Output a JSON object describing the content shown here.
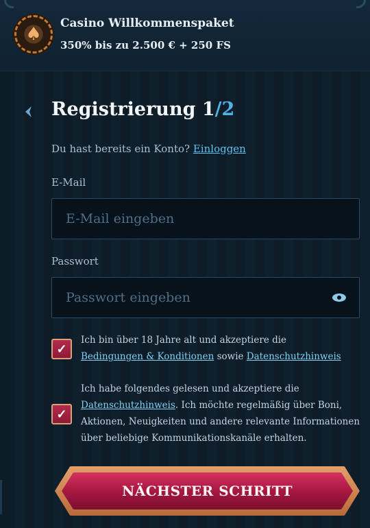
{
  "banner": {
    "title": "Casino Willkommenspaket",
    "subtitle": "350% bis zu 2.500 € + 250 FS"
  },
  "form": {
    "title_main": "Registrierung 1",
    "title_step": "/2",
    "login_prompt": "Du hast bereits ein Konto?",
    "login_link": "Einloggen",
    "email_label": "E-Mail",
    "email_placeholder": "E-Mail eingeben",
    "password_label": "Passwort",
    "password_placeholder": "Passwort eingeben",
    "consent1_text": "Ich bin über 18 Jahre alt und akzeptiere die",
    "consent1_link1": "Bedingungen & Konditionen",
    "consent1_mid": "sowie",
    "consent1_link2": "Datenschutzhinweis",
    "consent1_checked": true,
    "consent2_text": "Ich habe folgendes gelesen und akzeptiere die",
    "consent2_link": "Datenschutzhinweis",
    "consent2_rest": ". Ich möchte regelmäßig über Boni, Aktionen, Neuigkeiten und andere relevante Informationen über beliebige Kommunikationskanäle erhalten.",
    "consent2_checked": true,
    "next_button": "NÄCHSTER SCHRITT",
    "check_glyph": "✓"
  },
  "icons": {
    "chip": "poker-chip-icon",
    "back": "chevron-left-icon",
    "eye": "eye-icon"
  },
  "colors": {
    "accent": "#4fb3e6",
    "button": "#a3163f",
    "checkbox": "#b42a4c",
    "background": "#0d1d28"
  }
}
